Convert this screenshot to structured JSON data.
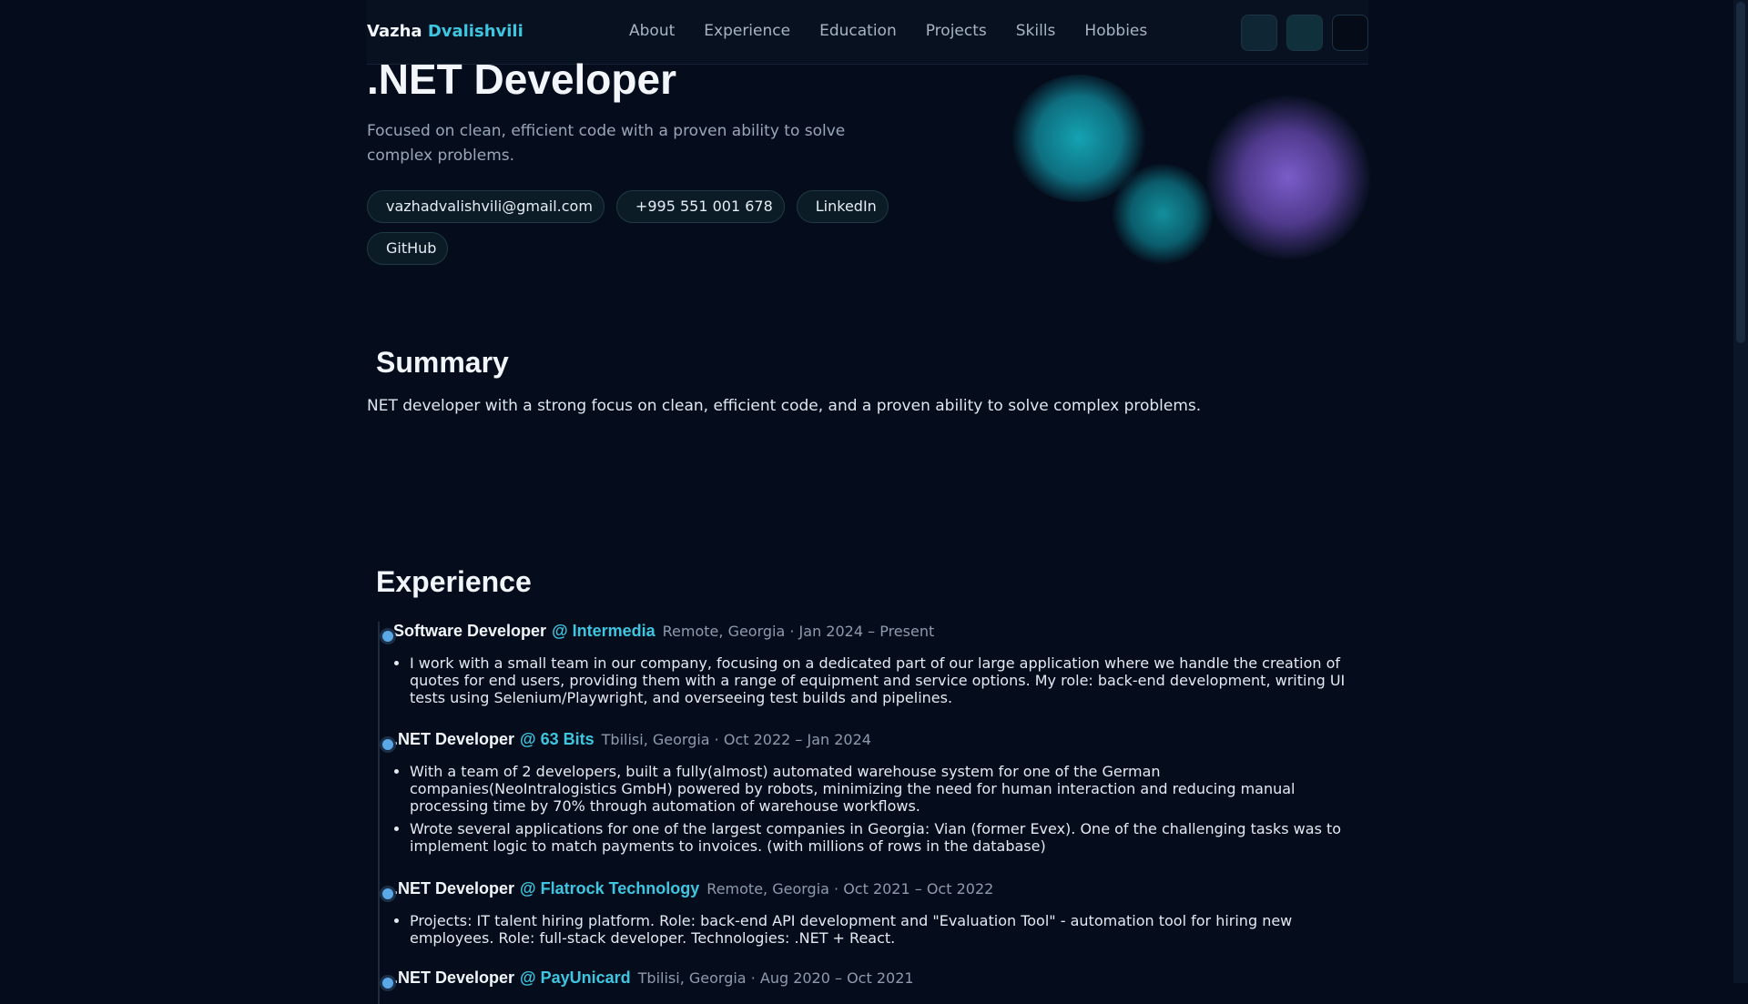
{
  "nav": {
    "brand_first": "Vazha",
    "brand_last": "Dvalishvili",
    "links": [
      "About",
      "Experience",
      "Education",
      "Projects",
      "Skills",
      "Hobbies"
    ]
  },
  "hero": {
    "title": ".NET Developer",
    "subtitle": "Focused on clean, efficient code with a proven ability to solve complex problems.",
    "contacts": [
      "vazhadvalishvili@gmail.com",
      "+995 551 001 678",
      "LinkedIn",
      "GitHub"
    ]
  },
  "summary": {
    "heading": "Summary",
    "text": "NET developer with a strong focus on clean, efficient code, and a proven ability to solve complex problems."
  },
  "experience": {
    "heading": "Experience",
    "jobs": [
      {
        "role": "Software Developer",
        "company": "@ Intermedia",
        "meta": "Remote, Georgia · Jan 2024 – Present",
        "bullets": [
          "I work with a small team in our company, focusing on a dedicated part of our large application where we handle the creation of quotes for end users, providing them with a range of equipment and service options. My role: back-end development, writing UI tests using Selenium/Playwright, and overseeing test builds and pipelines."
        ]
      },
      {
        "role": ".NET Developer",
        "company": "@ 63 Bits",
        "meta": "Tbilisi, Georgia · Oct 2022 – Jan 2024",
        "bullets": [
          "With a team of 2 developers, built a fully(almost) automated warehouse system for one of the German companies(NeoIntralogistics GmbH) powered by robots, minimizing the need for human interaction and reducing manual processing time by 70% through automation of warehouse workflows.",
          "Wrote several applications for one of the largest companies in Georgia: Vian (former Evex). One of the challenging tasks was to implement logic to match payments to invoices. (with millions of rows in the database)"
        ]
      },
      {
        "role": ".NET Developer",
        "company": "@ Flatrock Technology",
        "meta": "Remote, Georgia · Oct 2021 – Oct 2022",
        "bullets": [
          "Projects: IT talent hiring platform. Role: back-end API development and \"Evaluation Tool\" - automation tool for hiring new employees. Role: full-stack developer. Technologies: .NET + React."
        ]
      },
      {
        "role": ".NET Developer",
        "company": "@ PayUnicard",
        "meta": "Tbilisi, Georgia · Aug 2020 – Oct 2021",
        "bullets": []
      }
    ]
  }
}
